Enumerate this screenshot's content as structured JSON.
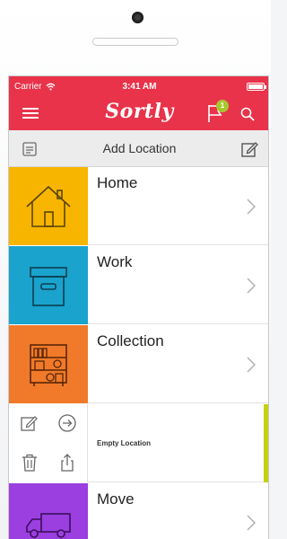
{
  "status_bar": {
    "carrier": "Carrier",
    "time": "3:41 AM"
  },
  "header": {
    "logo": "Sortly",
    "notification_count": "1",
    "brand_color": "#e8334a"
  },
  "toolbar": {
    "title": "Add Location"
  },
  "locations": [
    {
      "label": "Home",
      "color": "#f7b500",
      "icon": "house-icon"
    },
    {
      "label": "Work",
      "color": "#1aa3cc",
      "icon": "box-icon"
    },
    {
      "label": "Collection",
      "color": "#f07a2a",
      "icon": "bookshelf-icon"
    },
    {
      "label": "Empty Location",
      "color": "#c3d10f",
      "icon": "none"
    },
    {
      "label": "Move",
      "color": "#9b3fe0",
      "icon": "truck-icon"
    }
  ]
}
